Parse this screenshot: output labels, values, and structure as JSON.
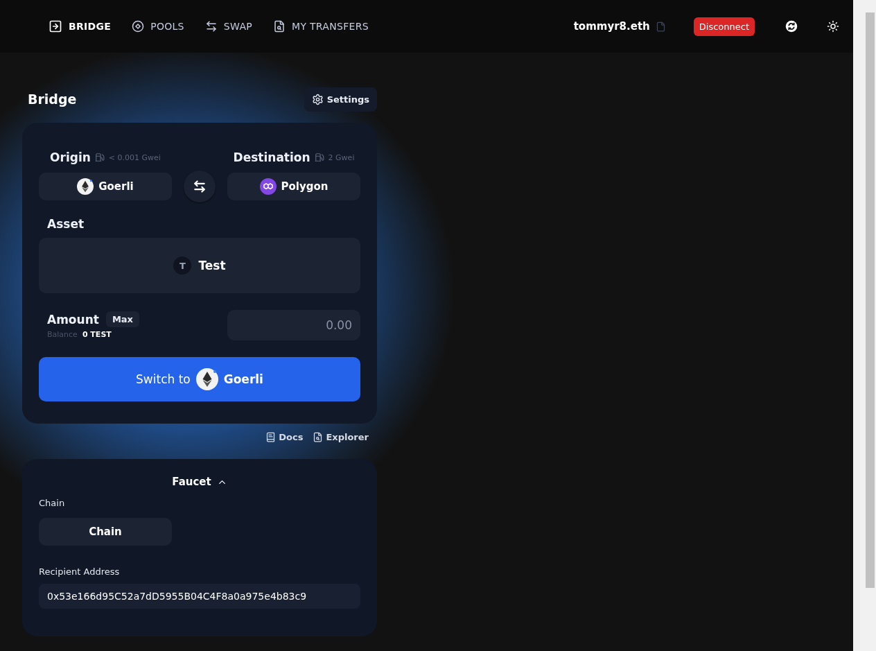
{
  "nav": {
    "items": [
      {
        "label": "BRIDGE",
        "selected": true,
        "kind": "bridge"
      },
      {
        "label": "POOLS",
        "selected": false,
        "kind": "pools"
      },
      {
        "label": "SWAP",
        "selected": false,
        "kind": "swap"
      },
      {
        "label": "MY TRANSFERS",
        "selected": false,
        "kind": "transfers"
      }
    ]
  },
  "account": {
    "name": "tommyr8.eth",
    "disconnect_button": "Disconnect"
  },
  "bridge": {
    "title": "Bridge",
    "settings_button": "Settings",
    "origin": {
      "label": "Origin",
      "gas": "< 0.001 Gwei",
      "chain": {
        "label": "Goerli",
        "kind": "ethereum"
      }
    },
    "destination": {
      "label": "Destination",
      "gas": "2 Gwei",
      "chain": {
        "label": "Polygon",
        "kind": "polygon"
      }
    },
    "asset": {
      "label": "Asset",
      "token": "Test",
      "token_letter": "T"
    },
    "amount": {
      "label": "Amount",
      "max_button": "Max",
      "balance_label": "Balance",
      "balance": "0 TEST",
      "placeholder": "0.00"
    },
    "action_button": {
      "prefix": "Switch to",
      "chain": {
        "label": "Goerli",
        "kind": "ethereum"
      }
    }
  },
  "links": [
    {
      "label": "Docs",
      "kind": "docs"
    },
    {
      "label": "Explorer",
      "kind": "explorer"
    }
  ],
  "faucet": {
    "title": "Faucet",
    "expanded": true,
    "chain_label": "Chain",
    "chain_button": "Chain",
    "recipient_label": "Recipient Address",
    "recipient": "0x53e166d95C52a7dD5955B04C4F8a0a975e4b83c9"
  }
}
